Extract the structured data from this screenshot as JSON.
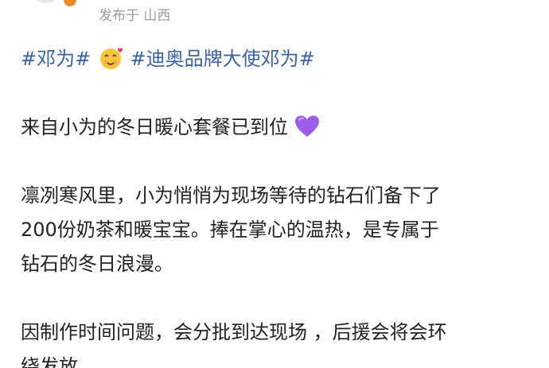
{
  "header": {
    "location_label": "发布于 山西"
  },
  "topics": {
    "first": "#邓为#",
    "second": "#迪奥品牌大使邓为#"
  },
  "icons": {
    "topic_emoji": "heart-face-emoji",
    "purple_heart": "purple-heart-emoji",
    "purple_heart_color": "#9b5de5",
    "topic_color": "#3b62a0"
  },
  "body": {
    "line1": "来自小为的冬日暖心套餐已到位",
    "para2_line1": "凛冽寒风里，小为悄悄为现场等待的钻石们备下了",
    "para2_line2": " 200份奶茶和暖宝宝。捧在掌心的温热，是专属于",
    "para2_line3": "钻石的冬日浪漫。",
    "para3_line1": "因制作时间问题，会分批到达现场 ，后援会将会环",
    "para3_line2": "绕发放"
  }
}
